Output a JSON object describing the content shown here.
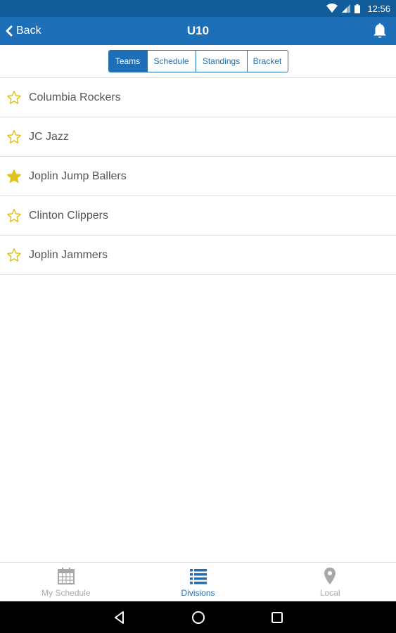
{
  "status_bar": {
    "time": "12:56"
  },
  "header": {
    "back_label": "Back",
    "title": "U10"
  },
  "tabs": [
    {
      "label": "Teams",
      "active": true
    },
    {
      "label": "Schedule",
      "active": false
    },
    {
      "label": "Standings",
      "active": false
    },
    {
      "label": "Bracket",
      "active": false
    }
  ],
  "teams": [
    {
      "name": "Columbia Rockers",
      "favorite": false
    },
    {
      "name": "JC Jazz",
      "favorite": false
    },
    {
      "name": "Joplin Jump Ballers",
      "favorite": true
    },
    {
      "name": "Clinton Clippers",
      "favorite": false
    },
    {
      "name": "Joplin Jammers",
      "favorite": false
    }
  ],
  "bottom_nav": [
    {
      "label": "My Schedule",
      "icon": "calendar-icon",
      "active": false
    },
    {
      "label": "Divisions",
      "icon": "list-icon",
      "active": true
    },
    {
      "label": "Local",
      "icon": "location-pin-icon",
      "active": false
    }
  ],
  "colors": {
    "primary": "#1d6fb8",
    "status_bar": "#135c9a",
    "star": "#e0c21a",
    "inactive": "#a8a8a8"
  }
}
